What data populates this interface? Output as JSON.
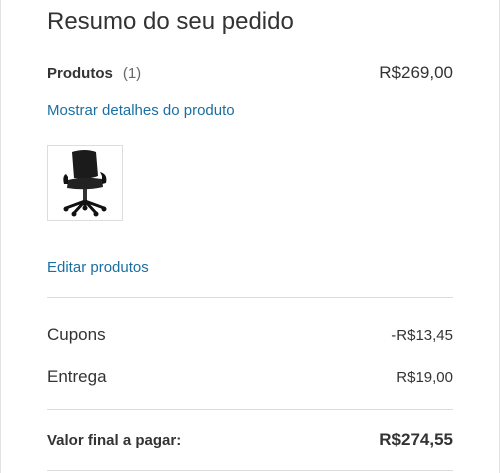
{
  "summary": {
    "title": "Resumo do seu pedido",
    "products_label": "Produtos",
    "products_count": "(1)",
    "products_total": "R$269,00",
    "details_link": "Mostrar detalhes do produto",
    "product_image_icon": "office-chair-icon",
    "edit_link": "Editar produtos",
    "coupons_label": "Cupons",
    "coupons_value": "-R$13,45",
    "delivery_label": "Entrega",
    "delivery_value": "R$19,00",
    "final_label": "Valor final a pagar:",
    "final_value": "R$274,55"
  },
  "colors": {
    "link": "#1a6fa1",
    "text": "#333333",
    "divider": "#dddddd"
  }
}
